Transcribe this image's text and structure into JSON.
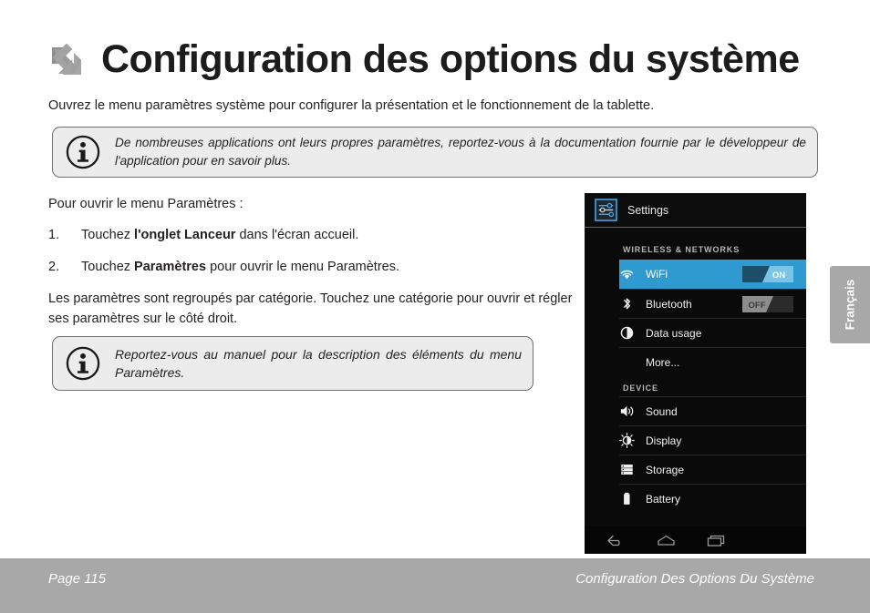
{
  "header": {
    "arrow_icon": "arrow-down-right-icon",
    "title": "Configuration des options du système"
  },
  "intro": "Ouvrez le menu paramètres système pour configurer la présentation et le fonctionnement de la tablette.",
  "notes": [
    {
      "icon": "info-icon",
      "text": "De nombreuses applications ont leurs propres paramètres, reportez-vous à la documentation fournie par le développeur de l'application pour en savoir plus."
    },
    {
      "icon": "info-icon",
      "text": "Reportez-vous au manuel pour la description des éléments du menu Paramètres."
    }
  ],
  "instructions": {
    "lead": "Pour ouvrir le menu Paramètres :",
    "steps": [
      {
        "num": "1.",
        "pre": "Touchez ",
        "bold": "l'onglet Lanceur",
        "post": " dans l'écran accueil."
      },
      {
        "num": "2.",
        "pre": "Touchez ",
        "bold": "Paramètres",
        "post": " pour ouvrir le menu Paramètres."
      }
    ],
    "paragraph": "Les paramètres sont regroupés par catégorie. Touchez une catégorie pour ouvrir et régler ses paramètres sur le côté droit."
  },
  "tablet": {
    "app_icon": "settings-sliders-icon",
    "app_title": "Settings",
    "sections": [
      {
        "label": "WIRELESS & NETWORKS",
        "rows": [
          {
            "icon": "wifi-icon",
            "label": "WiFi",
            "toggle": "ON",
            "selected": true
          },
          {
            "icon": "bluetooth-icon",
            "label": "Bluetooth",
            "toggle": "OFF",
            "selected": false
          },
          {
            "icon": "data-usage-icon",
            "label": "Data usage",
            "toggle": "",
            "selected": false
          },
          {
            "icon": "",
            "label": "More...",
            "toggle": "",
            "selected": false
          }
        ]
      },
      {
        "label": "DEVICE",
        "rows": [
          {
            "icon": "sound-icon",
            "label": "Sound",
            "toggle": "",
            "selected": false
          },
          {
            "icon": "display-icon",
            "label": "Display",
            "toggle": "",
            "selected": false
          },
          {
            "icon": "storage-icon",
            "label": "Storage",
            "toggle": "",
            "selected": false
          },
          {
            "icon": "battery-icon",
            "label": "Battery",
            "toggle": "",
            "selected": false
          }
        ]
      }
    ],
    "nav": [
      {
        "icon": "back-icon"
      },
      {
        "icon": "home-icon"
      },
      {
        "icon": "recents-icon"
      }
    ],
    "colors": {
      "selected_row": "#2e9ad0",
      "background": "#0a0a0a"
    }
  },
  "language_tab": {
    "label": "Français"
  },
  "footer": {
    "page": "Page 115",
    "section": "Configuration Des Options Du Système",
    "background": "#a8a8a8"
  }
}
